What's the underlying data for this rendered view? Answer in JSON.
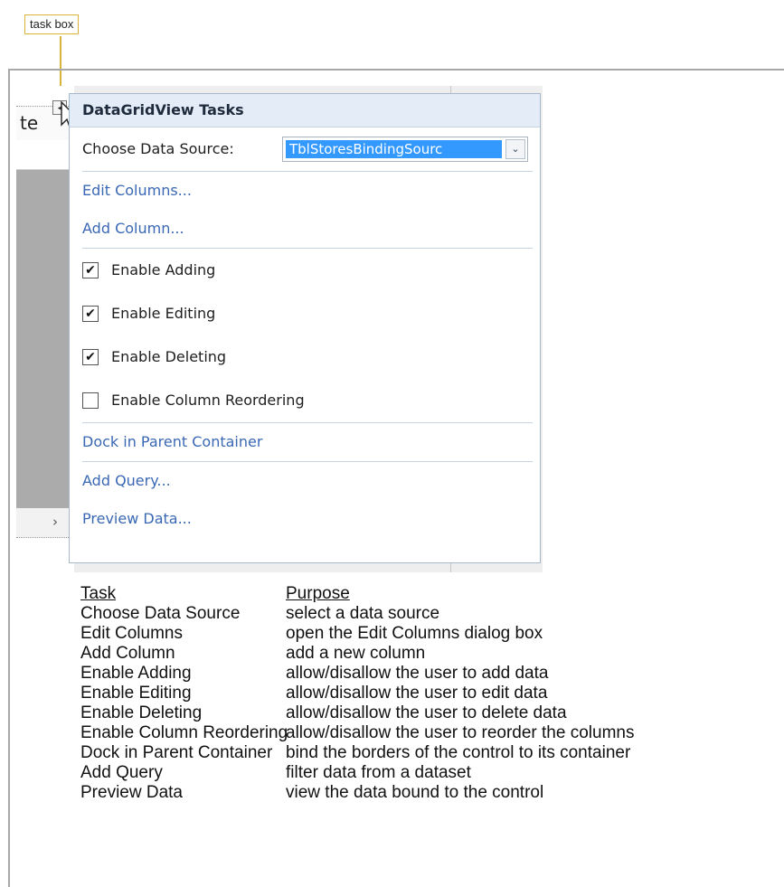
{
  "callout": {
    "label": "task box"
  },
  "grid": {
    "header_text": "te",
    "scroll_arrow": "›",
    "smart_tag_glyph": "◂"
  },
  "panel": {
    "title": "DataGridView Tasks",
    "data_source_label": "Choose Data Source:",
    "data_source_value": "TblStoresBindingSourc",
    "dropdown_glyph": "⌄",
    "links_top": [
      "Edit Columns...",
      "Add Column..."
    ],
    "checkboxes": [
      {
        "label": "Enable Adding",
        "checked": true,
        "mark": "✔"
      },
      {
        "label": "Enable Editing",
        "checked": true,
        "mark": "✔"
      },
      {
        "label": "Enable Deleting",
        "checked": true,
        "mark": "✔"
      },
      {
        "label": "Enable Column Reordering",
        "checked": false,
        "mark": ""
      }
    ],
    "dock_link": "Dock in Parent Container",
    "links_bottom": [
      "Add Query...",
      "Preview Data..."
    ]
  },
  "table": {
    "header_task": "Task",
    "header_purpose": "Purpose",
    "rows": [
      {
        "task": "Choose Data Source",
        "purpose": "select a data source"
      },
      {
        "task": "Edit Columns",
        "purpose": "open the Edit Columns dialog box"
      },
      {
        "task": "Add Column",
        "purpose": "add a new column"
      },
      {
        "task": "Enable Adding",
        "purpose": "allow/disallow the user to add data"
      },
      {
        "task": "Enable Editing",
        "purpose": "allow/disallow the user to edit data"
      },
      {
        "task": "Enable Deleting",
        "purpose": "allow/disallow the user to delete data"
      },
      {
        "task": "Enable Column Reordering",
        "purpose": "allow/disallow the user to reorder the columns"
      },
      {
        "task": "Dock in Parent Container",
        "purpose": "bind the borders of the control to its container"
      },
      {
        "task": "Add Query",
        "purpose": "filter data from a dataset"
      },
      {
        "task": "Preview Data",
        "purpose": "view the data bound to the control"
      }
    ]
  },
  "colors": {
    "callout_border": "#d9b33a",
    "title_bar": "#e4ecf7",
    "link": "#3a68b4",
    "selection": "#3399ff"
  }
}
